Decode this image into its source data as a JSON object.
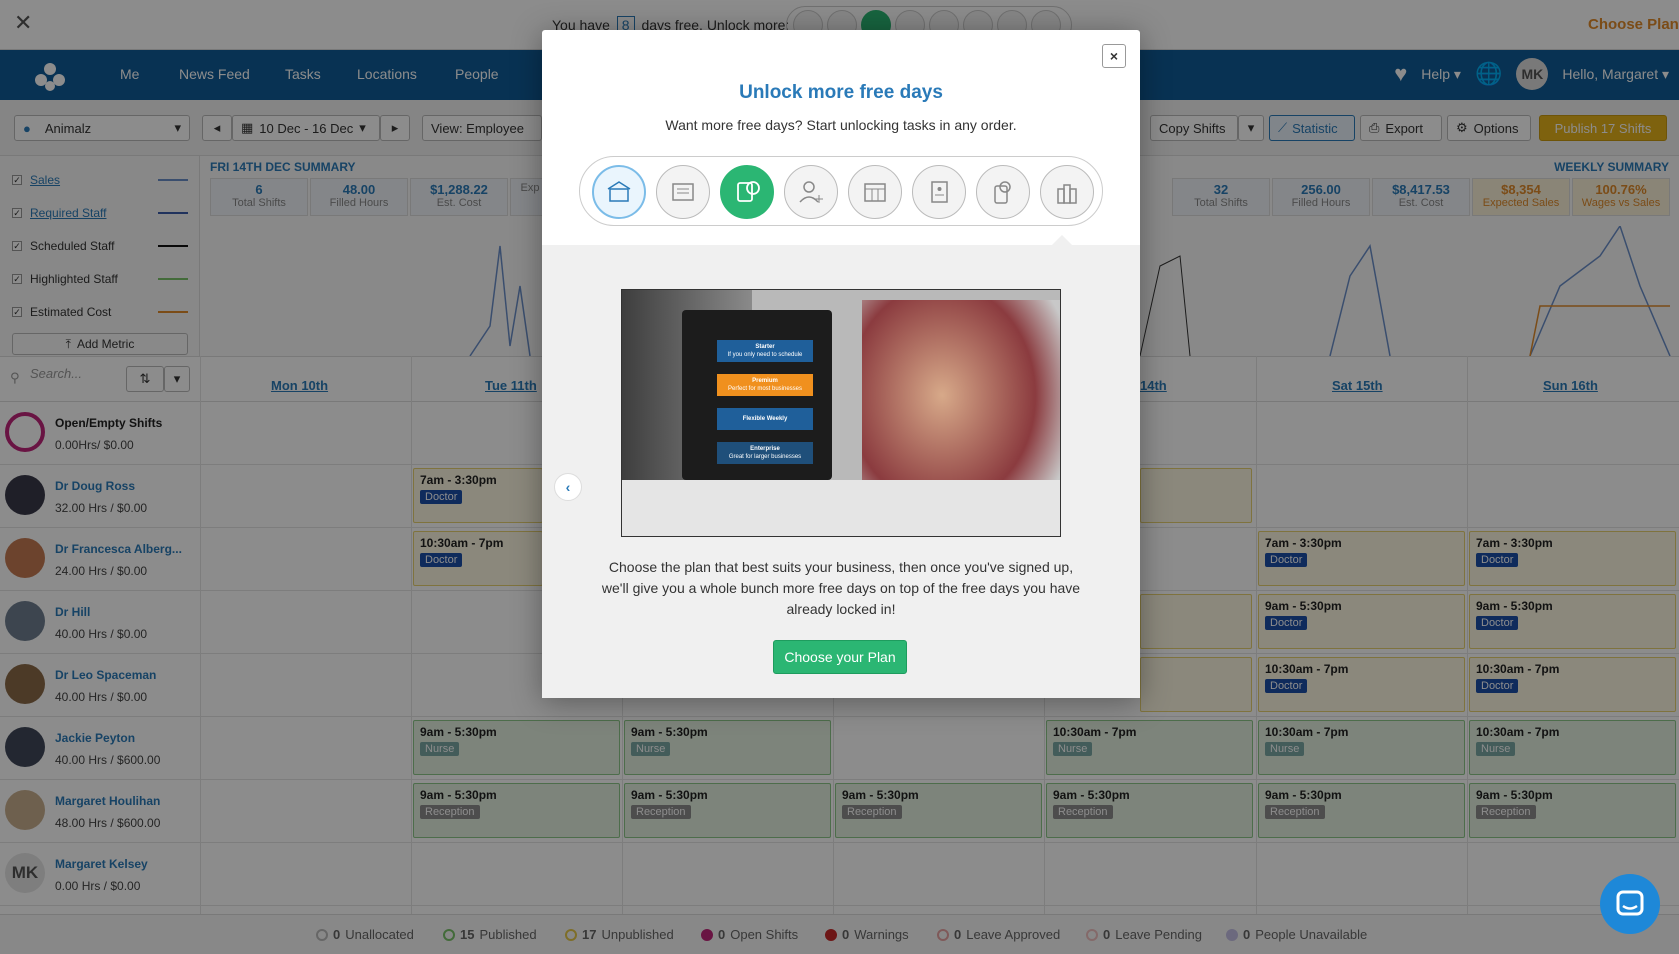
{
  "trial": {
    "text_before": "You have",
    "days": "8",
    "text_after": "days free. Unlock more:",
    "choose_plan": "Choose Plan"
  },
  "nav": {
    "items": [
      "Me",
      "News Feed",
      "Tasks",
      "Locations",
      "People"
    ],
    "help": "Help",
    "greeting": "Hello, Margaret",
    "avatar_initials": "MK"
  },
  "toolbar": {
    "location": "Animalz",
    "date_range": "10 Dec - 16 Dec",
    "view": "View: Employee",
    "copy_shifts": "Copy Shifts",
    "statistic": "Statistic",
    "export": "Export",
    "options": "Options",
    "publish": "Publish 17 Shifts"
  },
  "metrics": {
    "items": [
      {
        "label": "Sales",
        "color": "#6b8ec9",
        "link": true
      },
      {
        "label": "Required Staff",
        "color": "#3b5ba9",
        "link": true
      },
      {
        "label": "Scheduled Staff",
        "color": "#111111",
        "link": false
      },
      {
        "label": "Highlighted Staff",
        "color": "#7ac36a",
        "link": false
      },
      {
        "label": "Estimated Cost",
        "color": "#e08a2a",
        "link": false
      }
    ],
    "add_metric": "Add Metric"
  },
  "summary": {
    "day_title": "FRI 14TH DEC SUMMARY",
    "weekly_title": "WEEKLY SUMMARY",
    "day_cells": [
      {
        "value": "6",
        "label": "Total Shifts"
      },
      {
        "value": "48.00",
        "label": "Filled Hours"
      },
      {
        "value": "$1,288.22",
        "label": "Est. Cost"
      },
      {
        "value": "",
        "label": "Exp"
      }
    ],
    "weekly_cells": [
      {
        "value": "32",
        "label": "Total Shifts"
      },
      {
        "value": "256.00",
        "label": "Filled Hours"
      },
      {
        "value": "$8,417.53",
        "label": "Est. Cost"
      },
      {
        "value": "$8,354",
        "label": "Expected Sales"
      },
      {
        "value": "100.76%",
        "label": "Wages vs Sales"
      }
    ]
  },
  "grid": {
    "search_placeholder": "Search...",
    "days": [
      "Mon 10th",
      "Tue 11th",
      "14th",
      "Sat 15th",
      "Sun 16th"
    ],
    "staff": [
      {
        "name": "Open/Empty Shifts",
        "hours": "0.00Hrs/ $0.00"
      },
      {
        "name": "Dr Doug Ross",
        "hours": "32.00 Hrs / $0.00"
      },
      {
        "name": "Dr Francesca Alberg...",
        "hours": "24.00 Hrs / $0.00"
      },
      {
        "name": "Dr Hill",
        "hours": "40.00 Hrs / $0.00"
      },
      {
        "name": "Dr Leo Spaceman",
        "hours": "40.00 Hrs / $0.00"
      },
      {
        "name": "Jackie Peyton",
        "hours": "40.00 Hrs / $600.00"
      },
      {
        "name": "Margaret Houlihan",
        "hours": "48.00 Hrs / $600.00"
      },
      {
        "name": "Margaret Kelsey",
        "hours": "0.00 Hrs / $0.00",
        "initials": "MK"
      }
    ],
    "shifts": {
      "s1": {
        "time": "7am - 3:30pm",
        "role": "Doctor"
      },
      "s2": {
        "time": "10:30am - 7pm",
        "role": "Doctor"
      },
      "s3": {
        "time": "7am - 3:30pm",
        "role": "Doctor"
      },
      "s4": {
        "time": "7am - 3:30pm",
        "role": "Doctor"
      },
      "s5": {
        "time": "9am - 5:30pm",
        "role": "Doctor"
      },
      "s6": {
        "time": "9am - 5:30pm",
        "role": "Doctor"
      },
      "s7": {
        "time": "10:30am - 7pm",
        "role": "Doctor"
      },
      "s8": {
        "time": "10:30am - 7pm",
        "role": "Doctor"
      },
      "n1": {
        "time": "9am - 5:30pm",
        "role": "Nurse"
      },
      "n2": {
        "time": "9am - 5:30pm",
        "role": "Nurse"
      },
      "n3": {
        "time": "10:30am - 7pm",
        "role": "Nurse"
      },
      "n4": {
        "time": "10:30am - 7pm",
        "role": "Nurse"
      },
      "n5": {
        "time": "10:30am - 7pm",
        "role": "Nurse"
      },
      "r1": {
        "time": "9am - 5:30pm",
        "role": "Reception"
      },
      "r2": {
        "time": "9am - 5:30pm",
        "role": "Reception"
      },
      "r3": {
        "time": "9am - 5:30pm",
        "role": "Reception"
      },
      "r4": {
        "time": "9am - 5:30pm",
        "role": "Reception"
      },
      "r5": {
        "time": "9am - 5:30pm",
        "role": "Reception"
      },
      "r6": {
        "time": "9am - 5:30pm",
        "role": "Reception"
      }
    }
  },
  "footer": {
    "legend": [
      {
        "count": "0",
        "label": "Unallocated",
        "color": "#bbbbbb"
      },
      {
        "count": "15",
        "label": "Published",
        "color": "#7ac36a"
      },
      {
        "count": "17",
        "label": "Unpublished",
        "color": "#e6c84a"
      },
      {
        "count": "0",
        "label": "Open Shifts",
        "color": "#c0267a"
      },
      {
        "count": "0",
        "label": "Warnings",
        "color": "#c62828"
      },
      {
        "count": "0",
        "label": "Leave Approved",
        "color": "#e8a3a3"
      },
      {
        "count": "0",
        "label": "Leave Pending",
        "color": "#f0c0c0"
      },
      {
        "count": "0",
        "label": "People Unavailable",
        "color": "#c5c0e6"
      }
    ]
  },
  "modal": {
    "title": "Unlock more free days",
    "subtitle": "Want more free days? Start unlocking tasks in any order.",
    "plans": [
      {
        "name": "Starter",
        "desc": "If you only need to schedule",
        "color": "#1f5f9a"
      },
      {
        "name": "Premium",
        "desc": "Perfect for most businesses",
        "color": "#f0901e"
      },
      {
        "name": "Flexible Weekly",
        "desc": "",
        "color": "#1f5f9a"
      },
      {
        "name": "Enterprise",
        "desc": "Great for larger businesses",
        "color": "#1f4f7a"
      }
    ],
    "body_text": "Choose the plan that best suits your business, then once you've signed up, we'll give you a whole bunch more free days on top of the free days you have already locked in!",
    "cta": "Choose your Plan",
    "close": "×"
  },
  "colors": {
    "brand_blue": "#0f5c97",
    "accent_green": "#2bb673",
    "publish_gold": "#e6b21a"
  }
}
